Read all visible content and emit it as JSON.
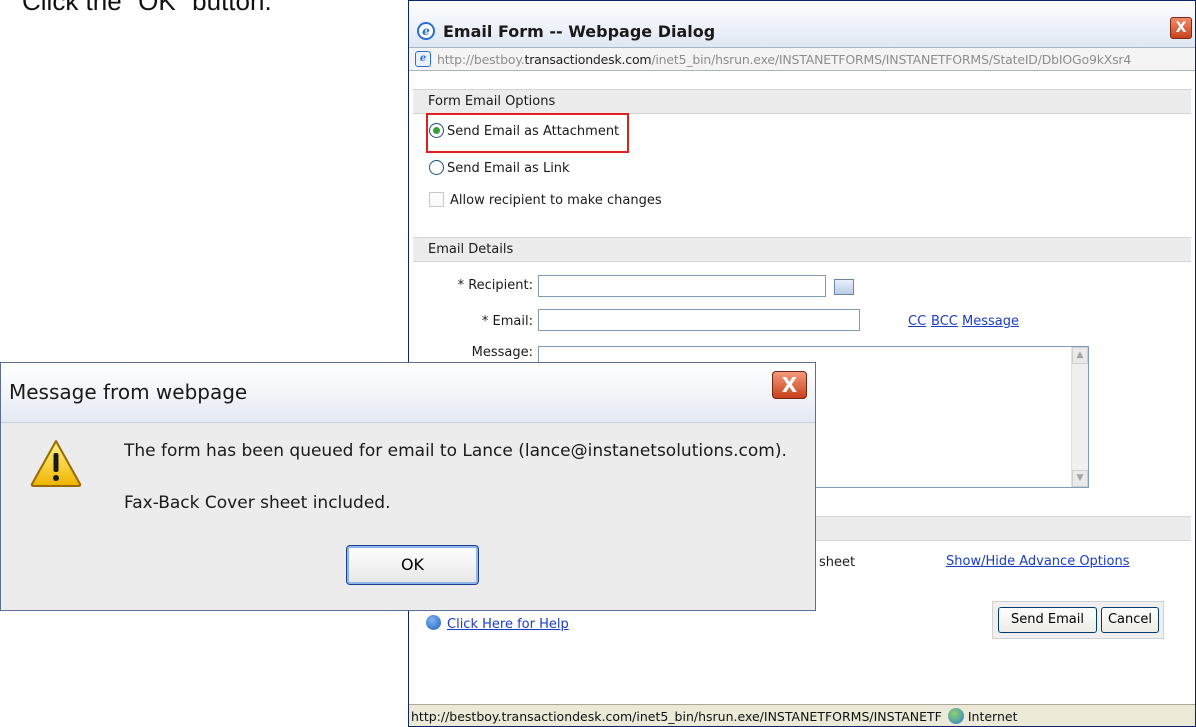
{
  "instruction": "Click the \"OK\" button.",
  "email_dialog": {
    "title": "Email Form -- Webpage Dialog",
    "close_label": "X",
    "address": {
      "prefix": "http://bestboy.",
      "domain": "transactiondesk.com",
      "path": "/inet5_bin/hsrun.exe/INSTANETFORMS/INSTANETFORMS/StateID/DbIOGo9kXsr4"
    },
    "form_email_options": {
      "header": "Form Email Options",
      "attachment_label": "Send Email as Attachment",
      "link_label": "Send Email as Link",
      "allow_changes_label": "Allow recipient to make changes"
    },
    "email_details": {
      "header": "Email Details",
      "recipient_label": "* Recipient:",
      "email_label": "* Email:",
      "message_label": "Message:",
      "cc_label": "CC",
      "bcc_label": "BCC",
      "message_link_label": "Message"
    },
    "advanced": {
      "partial_text": "sheet",
      "show_hide_label": "Show/Hide Advance Options"
    },
    "help_label": "Click Here for Help",
    "send_email_label": "Send Email",
    "cancel_label": "Cancel",
    "status_url": "http://bestboy.transactiondesk.com/inet5_bin/hsrun.exe/INSTANETFORMS/INSTANETF",
    "status_zone": "Internet"
  },
  "alert": {
    "title": "Message from webpage",
    "close_label": "X",
    "message_line1": "The form has been queued for email to Lance (lance@instanetsolutions.com).",
    "message_line2": "Fax-Back Cover sheet included.",
    "ok_label": "OK"
  }
}
